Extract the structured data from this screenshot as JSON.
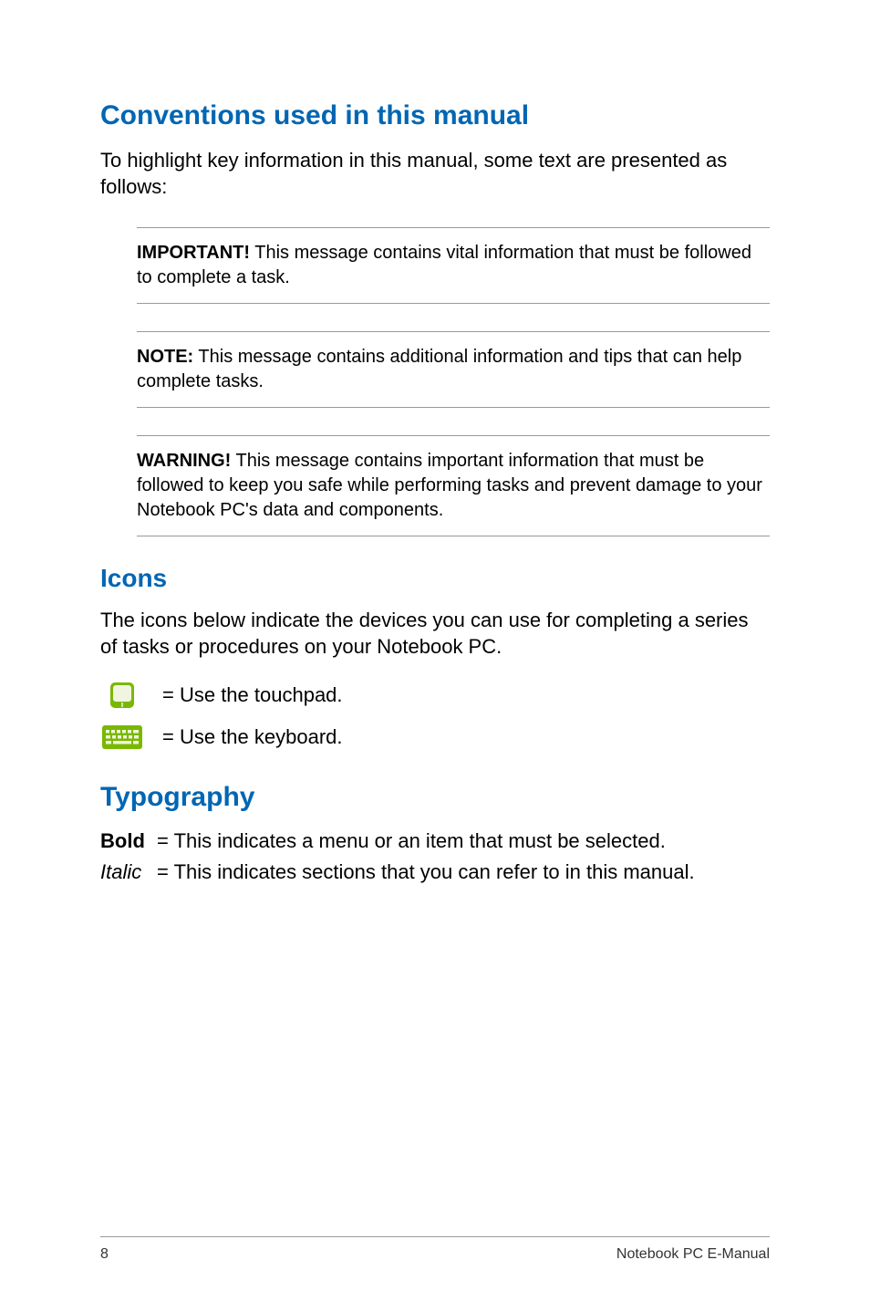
{
  "conventions": {
    "heading": "Conventions used in this manual",
    "intro": "To highlight key information in this manual, some text are presented as follows:",
    "important_label": "IMPORTANT!",
    "important_text": " This message contains vital information that must be followed to complete a task.",
    "note_label": "NOTE:",
    "note_text": " This message contains additional information and tips that can help complete tasks.",
    "warning_label": "WARNING!",
    "warning_text": " This message contains important information that must be followed to keep you safe while performing tasks and prevent damage to your Notebook PC's data and components."
  },
  "icons": {
    "heading": "Icons",
    "intro": "The icons below indicate the devices you can use for completing a series of tasks or procedures on your Notebook PC.",
    "touchpad_text": "= Use the touchpad.",
    "keyboard_text": "= Use the keyboard."
  },
  "typography": {
    "heading": "Typography",
    "bold_label": "Bold",
    "bold_text": "= This indicates a menu or an item that must be selected.",
    "italic_label": "Italic",
    "italic_text": "= This indicates sections that you can refer to in this manual."
  },
  "footer": {
    "page_number": "8",
    "title": "Notebook PC E-Manual"
  },
  "colors": {
    "heading_blue": "#0066b3",
    "icon_green": "#7ab800",
    "icon_light": "#f0f5e0"
  }
}
